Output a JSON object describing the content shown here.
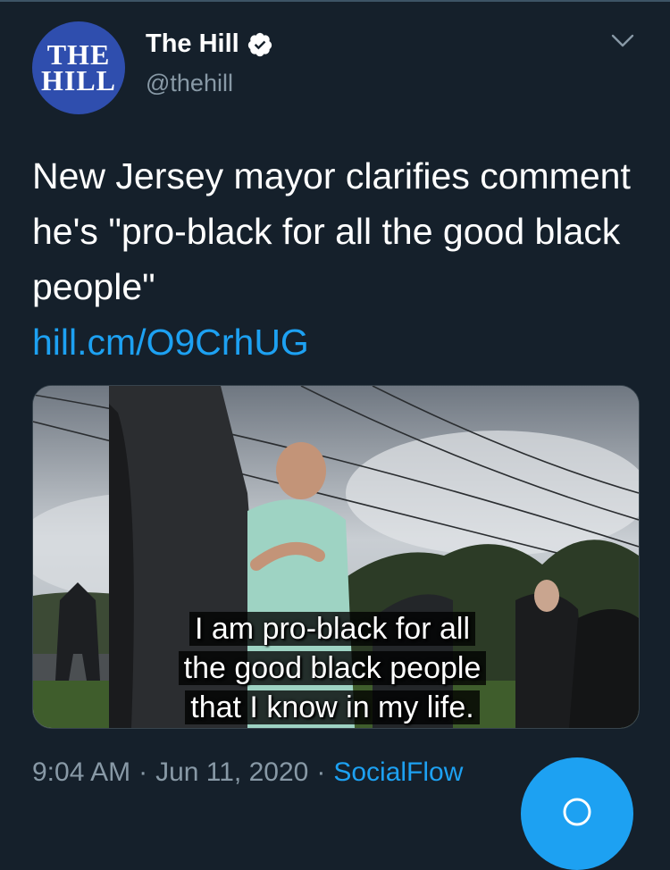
{
  "account": {
    "avatar_line1": "THE",
    "avatar_line2": "HILL",
    "name": "The Hill",
    "handle": "@thehill",
    "verified": true
  },
  "tweet": {
    "text": "New Jersey mayor clarifies comment he's \"pro-black for all the good black people\"",
    "link": "hill.cm/O9CrhUG"
  },
  "media": {
    "subtitle_lines": [
      "I am pro-black for all",
      "the good black people",
      "that I know in my life."
    ]
  },
  "meta": {
    "time": "9:04 AM",
    "separator": "·",
    "date": "Jun 11, 2020",
    "source": "SocialFlow"
  },
  "icons": {
    "verified": "verified-badge-icon",
    "more": "chevron-down-icon",
    "compose": "compose-icon"
  },
  "colors": {
    "background": "#15202b",
    "text": "#ffffff",
    "muted": "#8899a6",
    "accent": "#1da1f2",
    "avatar": "#2f4eae"
  }
}
